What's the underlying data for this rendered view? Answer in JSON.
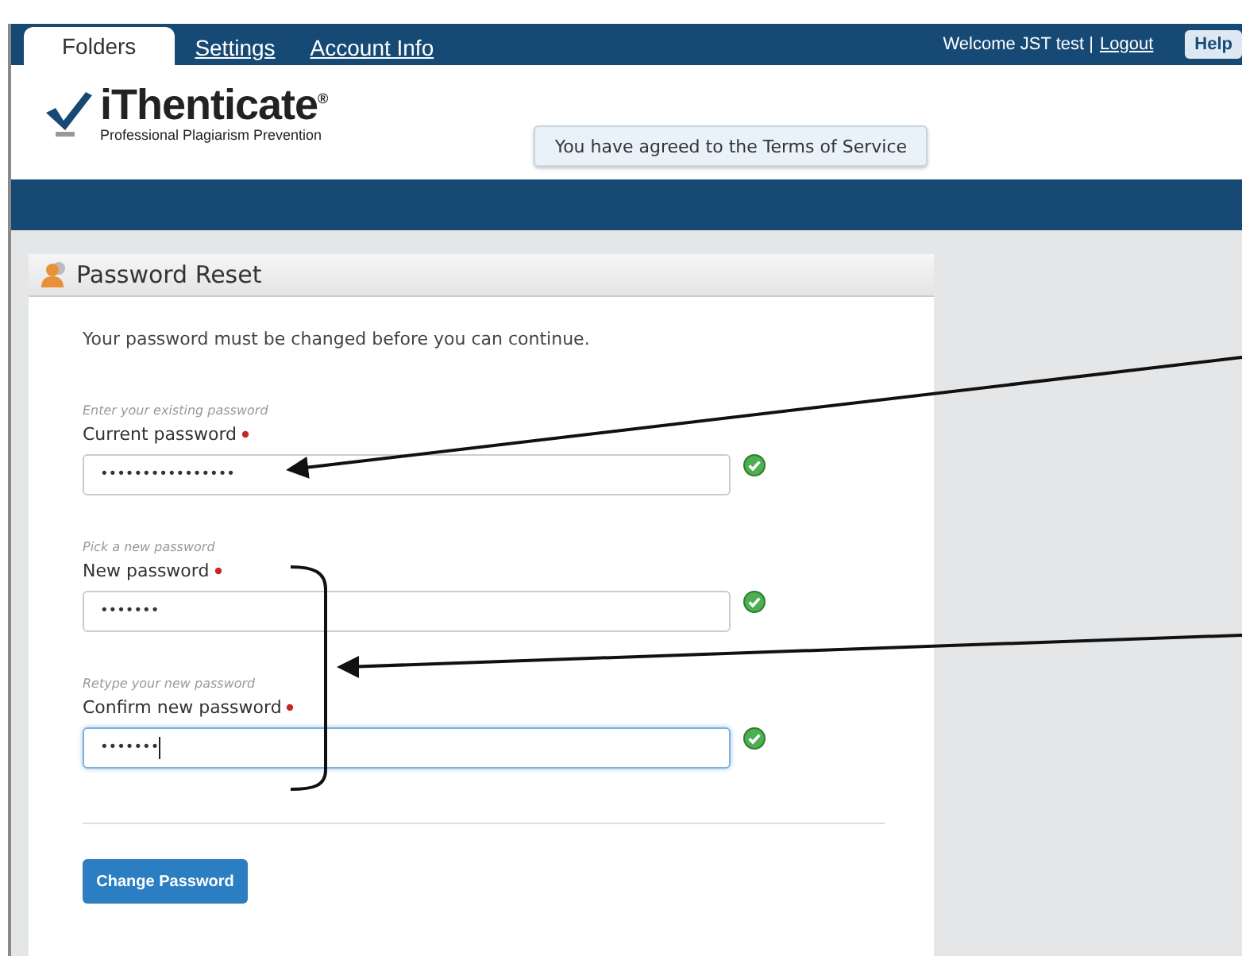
{
  "nav": {
    "tabs": [
      {
        "label": "Folders",
        "selected": true
      },
      {
        "label": "Settings",
        "selected": false
      },
      {
        "label": "Account Info",
        "selected": false
      }
    ],
    "welcome": "Welcome JST test |",
    "logout": "Logout",
    "help": "Help"
  },
  "logo": {
    "name": "iThenticate",
    "mark": "®",
    "tagline": "Professional Plagiarism Prevention"
  },
  "notice": "You have agreed to the Terms of Service",
  "panel": {
    "title": "Password Reset",
    "message": "Your password must be changed before you can continue.",
    "fields": [
      {
        "hint": "Enter your existing password",
        "label": "Current password",
        "required": true,
        "value": "••••••••••••••••",
        "valid": true,
        "focused": false
      },
      {
        "hint": "Pick a new password",
        "label": "New password",
        "required": true,
        "value": "•••••••",
        "valid": true,
        "focused": false
      },
      {
        "hint": "Retype your new password",
        "label": "Confirm new password",
        "required": true,
        "value": "•••••••",
        "valid": true,
        "focused": true
      }
    ],
    "submit": "Change Password"
  }
}
